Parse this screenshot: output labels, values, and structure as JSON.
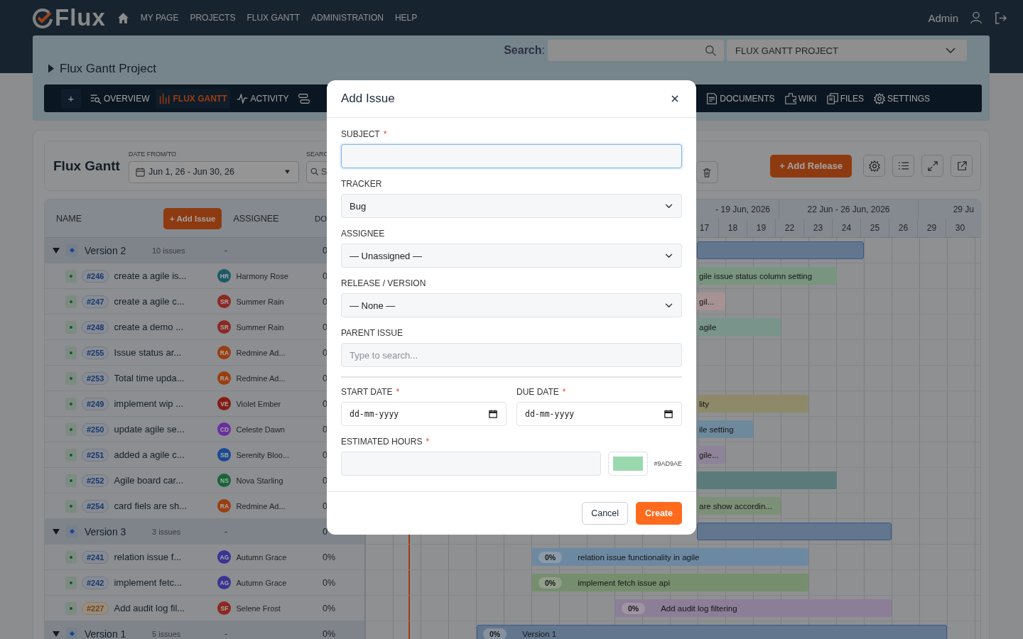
{
  "nav": {
    "logo": "Flux",
    "items": [
      "MY PAGE",
      "PROJECTS",
      "FLUX GANTT",
      "ADMINISTRATION",
      "HELP"
    ],
    "user": "Admin"
  },
  "project": {
    "add_tab": "+",
    "title": "Flux Gantt Project",
    "search_label": "Search",
    "search_colon": ":",
    "project_select": "FLUX GANTT PROJECT"
  },
  "tabs": [
    {
      "label": "OVERVIEW",
      "selected": false
    },
    {
      "label": "FLUX GANTT",
      "selected": true
    },
    {
      "label": "ACTIVITY",
      "selected": false
    },
    {
      "selected": false
    },
    {
      "label": "DOCUMENTS",
      "selected": false
    },
    {
      "label": "WIKI",
      "selected": false
    },
    {
      "label": "FILES",
      "selected": false
    },
    {
      "label": "SETTINGS",
      "selected": false
    }
  ],
  "toolbar": {
    "title": "Flux Gantt",
    "date_label": "DATE FROM/TO",
    "date_range": "Jun 1, 26 - Jun 30, 26",
    "search_label": "SEARC",
    "search_placeholder": "S",
    "add_release": "+ Add Release"
  },
  "table": {
    "columns": [
      "NAME",
      "ASSIGNEE",
      "DO"
    ],
    "add_issue": "+ Add Issue",
    "weeks": [
      "- 19 Jun, 2026",
      "22 Jun - 26 Jun, 2026",
      "29 Ju"
    ],
    "days": [
      "17",
      "18",
      "19",
      "22",
      "23",
      "24",
      "25",
      "26",
      "29",
      "30"
    ],
    "rows": [
      {
        "kind": "version",
        "name": "Version 2",
        "count": "10 issues",
        "assignee": "-",
        "done": "0",
        "expanded": true,
        "bar": {
          "color": "#63778f"
        }
      },
      {
        "kind": "issue",
        "id": "#246",
        "flagged": false,
        "name": "create a agile is...",
        "initials": "HR",
        "assignee": "Harmony Rose",
        "color": "#1c5a66",
        "done": "0",
        "bar": {
          "label": "gile issue status column setting",
          "color": "#7a9580"
        }
      },
      {
        "kind": "issue",
        "id": "#247",
        "flagged": false,
        "name": "create a agile c...",
        "initials": "SR",
        "assignee": "Summer Rain",
        "color": "#8b2a22",
        "done": "0",
        "bar": {
          "label": "gil...",
          "color": "#a89294"
        }
      },
      {
        "kind": "issue",
        "id": "#248",
        "flagged": false,
        "name": "create a demo ...",
        "initials": "SR",
        "assignee": "Summer Rain",
        "color": "#8b2a22",
        "done": "0",
        "bar": {
          "label": "agile",
          "color": "#7a968c"
        }
      },
      {
        "kind": "issue",
        "id": "#255",
        "flagged": false,
        "name": "Issue status ar...",
        "initials": "RA",
        "assignee": "Redmine Ad...",
        "color": "#9b3f10",
        "done": "0"
      },
      {
        "kind": "issue",
        "id": "#253",
        "flagged": false,
        "name": "Total time upda...",
        "initials": "RA",
        "assignee": "Redmine Ad...",
        "color": "#9b3f10",
        "done": "0"
      },
      {
        "kind": "issue",
        "id": "#249",
        "flagged": false,
        "name": "implement wip ...",
        "initials": "VE",
        "assignee": "Violet Ember",
        "color": "#861d14",
        "done": "0",
        "bar": {
          "label": "lity",
          "color": "#8f8a68"
        }
      },
      {
        "kind": "issue",
        "id": "#250",
        "flagged": false,
        "name": "update agile se...",
        "initials": "CD",
        "assignee": "Celeste Dawn",
        "color": "#6a2fa0",
        "done": "0",
        "bar": {
          "label": "ile setting",
          "color": "#6e8a9c"
        }
      },
      {
        "kind": "issue",
        "id": "#251",
        "flagged": false,
        "name": "added a agile c...",
        "initials": "SB",
        "assignee": "Serenity Bloo...",
        "color": "#1a4a94",
        "done": "0",
        "bar": {
          "label": "gile...",
          "color": "#8e8599"
        }
      },
      {
        "kind": "issue",
        "id": "#252",
        "flagged": false,
        "name": "Agile board car...",
        "initials": "NS",
        "assignee": "Nova Starling",
        "color": "#17663a",
        "done": "0",
        "bar": {
          "color": "#5c7b7b"
        }
      },
      {
        "kind": "issue",
        "id": "#254",
        "flagged": false,
        "name": "card fiels are sh...",
        "initials": "RA",
        "assignee": "Redmine Ad...",
        "color": "#9b3f10",
        "done": "0",
        "bar": {
          "label": "are show accordin...",
          "color": "#7b9177"
        }
      },
      {
        "kind": "version",
        "name": "Version 3",
        "count": "3 issues",
        "assignee": "-",
        "done": "0",
        "expanded": true,
        "bar": {
          "color": "#63778f"
        }
      },
      {
        "kind": "issue",
        "id": "#241",
        "flagged": false,
        "name": "relation issue f...",
        "initials": "AG",
        "assignee": "Autumn Grace",
        "color": "#3b3394",
        "done": "0%",
        "bar": {
          "progress": "0%",
          "label": "relation issue functionality in agile",
          "color": "#6e8aa3"
        }
      },
      {
        "kind": "issue",
        "id": "#242",
        "flagged": false,
        "name": "implement fetc...",
        "initials": "AG",
        "assignee": "Autumn Grace",
        "color": "#3b3394",
        "done": "0%",
        "bar": {
          "progress": "0%",
          "label": "implement fetch issue api",
          "color": "#768f6e"
        }
      },
      {
        "kind": "issue",
        "id": "#227",
        "flagged": true,
        "name": "Add audit log fil...",
        "initials": "SF",
        "assignee": "Selene Frost",
        "color": "#8b2a22",
        "done": "0%",
        "bar": {
          "progress": "0%",
          "label": "Add audit log filtering",
          "color": "#8e7f97"
        }
      },
      {
        "kind": "version",
        "name": "Version 1",
        "count": "5 issues",
        "assignee": "-",
        "done": "0%",
        "expanded": true,
        "bar": {
          "progress": "0%",
          "label": "Version 1",
          "color": "#63778f"
        }
      }
    ]
  },
  "dialog": {
    "title": "Add Issue",
    "required_mark": "*",
    "fields": [
      {
        "kind": "text",
        "label": "SUBJECT",
        "required": true,
        "focused": true
      },
      {
        "kind": "select",
        "label": "TRACKER",
        "required": false,
        "value": "Bug"
      },
      {
        "kind": "select",
        "label": "ASSIGNEE",
        "required": false,
        "value": "— Unassigned —"
      },
      {
        "kind": "select",
        "label": "RELEASE / VERSION",
        "required": false,
        "value": "— None —"
      },
      {
        "kind": "text",
        "label": "PARENT ISSUE",
        "required": false,
        "placeholder": "Type to search...",
        "focused": false
      }
    ],
    "dates": [
      {
        "label": "START DATE",
        "required": true,
        "placeholder": "dd-mm-yyyy"
      },
      {
        "label": "DUE DATE",
        "required": true,
        "placeholder": "dd-mm-yyyy"
      }
    ],
    "hours": {
      "label": "ESTIMATED HOURS",
      "required": true,
      "color": "#9AD9AE"
    },
    "buttons": {
      "cancel": "Cancel",
      "create": "Create"
    }
  }
}
